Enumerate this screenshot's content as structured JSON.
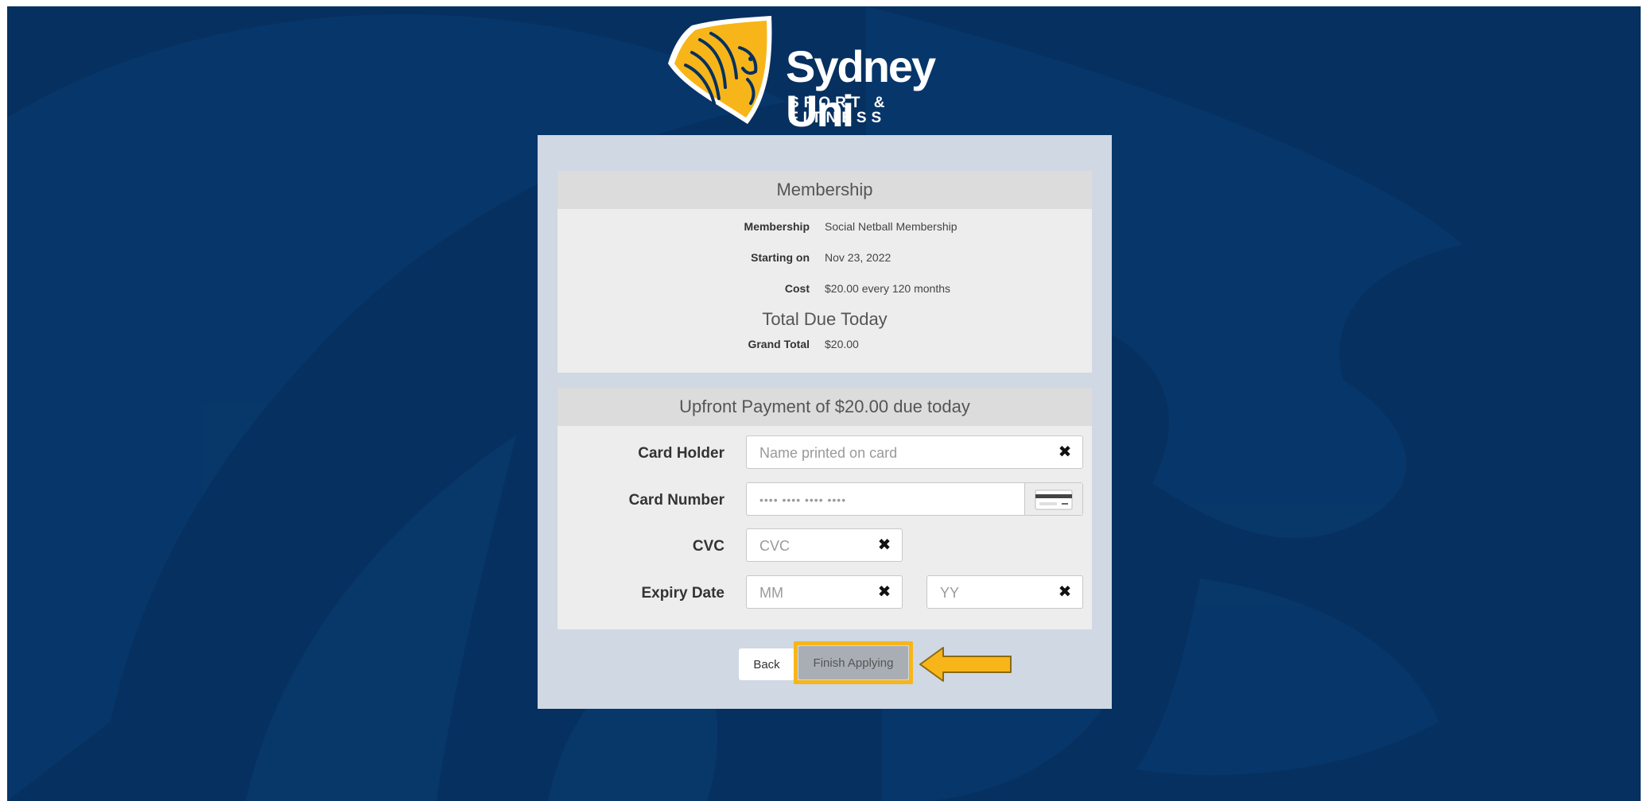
{
  "brand": {
    "title": "Sydney Uni",
    "subtitle": "SPORT & FITNESS",
    "colors": {
      "navy": "#06305f",
      "gold": "#f7b519"
    }
  },
  "membership_section": {
    "header": "Membership",
    "rows": [
      {
        "label": "Membership",
        "value": "Social Netball Membership"
      },
      {
        "label": "Starting on",
        "value": "Nov 23, 2022"
      },
      {
        "label": "Cost",
        "value": "$20.00 every 120 months"
      }
    ],
    "total_heading": "Total Due Today",
    "grand_total": {
      "label": "Grand Total",
      "value": "$20.00"
    }
  },
  "payment_section": {
    "header": "Upfront Payment of $20.00 due today",
    "card_holder": {
      "label": "Card Holder",
      "placeholder": "Name printed on card",
      "value": ""
    },
    "card_number": {
      "label": "Card Number",
      "placeholder": "•••• •••• •••• ••••",
      "value": ""
    },
    "cvc": {
      "label": "CVC",
      "placeholder": "CVC",
      "value": ""
    },
    "expiry": {
      "label": "Expiry Date",
      "month_placeholder": "MM",
      "year_placeholder": "YY"
    },
    "clear_icon": "close-icon",
    "card_icon": "credit-card-icon"
  },
  "actions": {
    "back_label": "Back",
    "finish_label": "Finish Applying"
  }
}
